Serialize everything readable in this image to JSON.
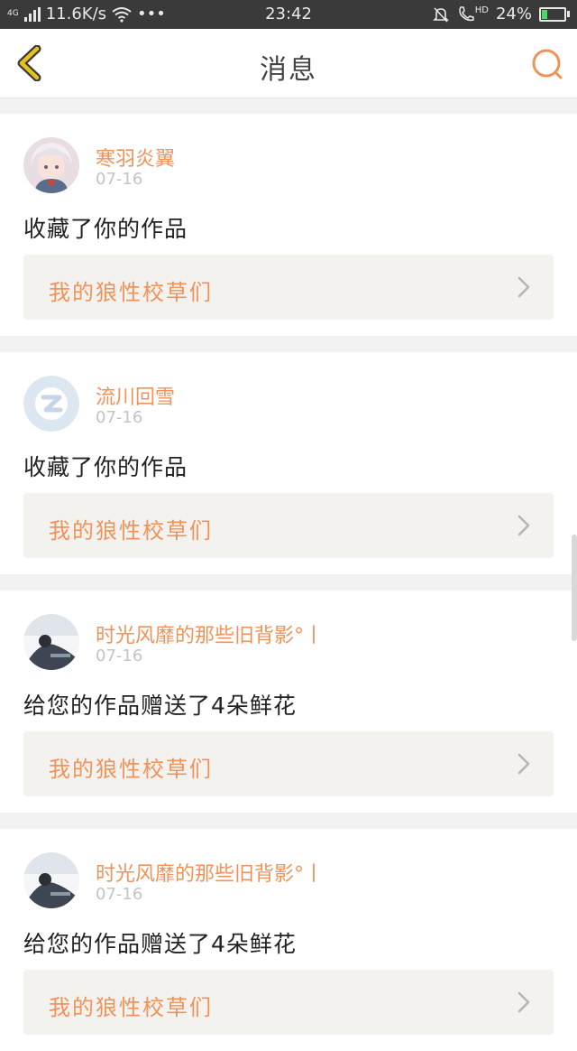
{
  "status_bar": {
    "network": "4G",
    "speed": "11.6K/s",
    "more": "•••",
    "time": "23:42",
    "hd": "HD",
    "battery": "24%",
    "battery_level": 0.24
  },
  "header": {
    "title": "消息"
  },
  "colors": {
    "accent": "#f0935a",
    "back_icon": "#e8c21c"
  },
  "messages": [
    {
      "username": "寒羽炎翼",
      "date": "07-16",
      "action": "收藏了你的作品",
      "work_title": "我的狼性校草们",
      "avatar": "avatar-anime"
    },
    {
      "username": "流川回雪",
      "date": "07-16",
      "action": "收藏了你的作品",
      "work_title": "我的狼性校草们",
      "avatar": "avatar-default-qq"
    },
    {
      "username": "时光风靡的那些旧背影°丨",
      "date": "07-16",
      "action": "给您的作品赠送了4朵鲜花",
      "work_title": "我的狼性校草们",
      "avatar": "avatar-photo"
    },
    {
      "username": "时光风靡的那些旧背影°丨",
      "date": "07-16",
      "action": "给您的作品赠送了4朵鲜花",
      "work_title": "我的狼性校草们",
      "avatar": "avatar-photo"
    }
  ]
}
